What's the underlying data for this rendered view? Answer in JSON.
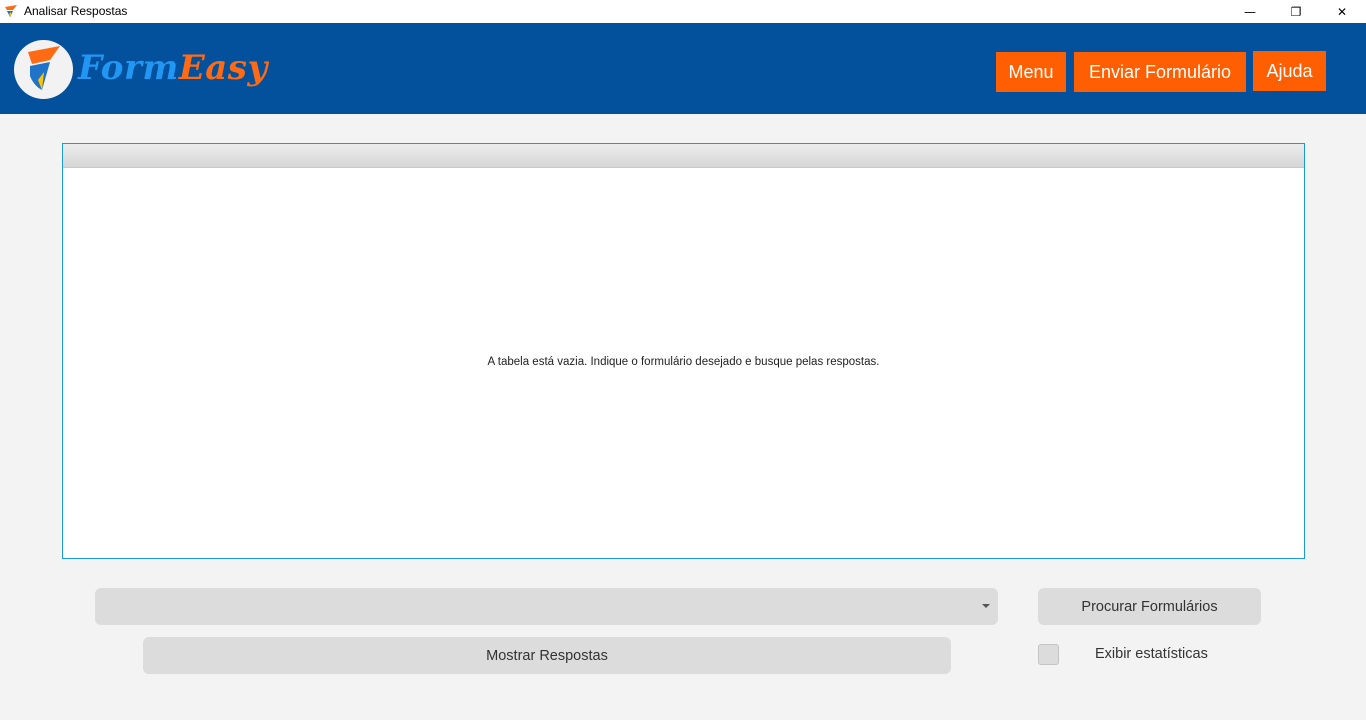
{
  "window": {
    "title": "Analisar Respostas",
    "minimize_glyph": "—",
    "maximize_glyph": "❐",
    "close_glyph": "✕"
  },
  "header": {
    "logo_part1": "Form",
    "logo_part2": "Easy",
    "buttons": {
      "menu": "Menu",
      "enviar": "Enviar Formulário",
      "ajuda": "Ajuda"
    }
  },
  "table": {
    "empty_message": "A tabela está vazia. Indique o formulário desejado e busque pelas respostas."
  },
  "controls": {
    "form_select_value": "",
    "procurar_label": "Procurar Formulários",
    "mostrar_label": "Mostrar Respostas",
    "estatisticas_label": "Exibir estatísticas",
    "estatisticas_checked": false
  },
  "colors": {
    "header_bg": "#03519c",
    "accent_orange": "#ff5f00",
    "logo_blue": "#2196f3",
    "table_border": "#1a9bd7"
  },
  "icons": {
    "app": "formeasy-logo-icon",
    "combo_arrow": "chevron-down-icon"
  }
}
